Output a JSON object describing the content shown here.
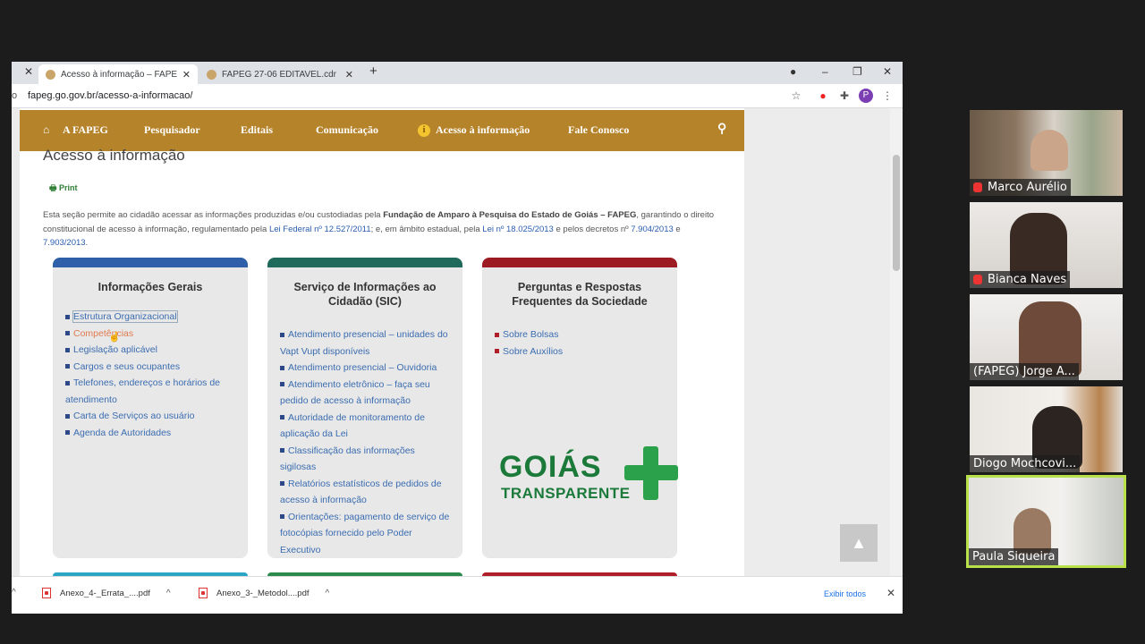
{
  "browser": {
    "tabs": [
      {
        "title": "Acesso à informação – FAPEG – F",
        "close": "✕"
      },
      {
        "title": "FAPEG 27-06 EDITAVEL.cdr",
        "close": "✕"
      }
    ],
    "new_tab": "+",
    "url": "fapeg.go.gov.br/acesso-a-informacao/",
    "profile_initial": "P"
  },
  "nav": {
    "items": [
      "A FAPEG",
      "Pesquisador",
      "Editais",
      "Comunicação",
      "Acesso à informação",
      "Fale Conosco"
    ]
  },
  "page": {
    "title": "Acesso à informação",
    "print": "Print",
    "intro_1": "Esta seção permite ao cidadão acessar as informações produzidas e/ou custodiadas pela ",
    "intro_bold": "Fundação de Amparo à Pesquisa do Estado de Goiás – FAPEG",
    "intro_2": ", garantindo o direito constitucional de acesso à informação, regulamentado pela ",
    "intro_link1": "Lei Federal nº 12.527/2011",
    "intro_3": "; e, em âmbito estadual, pela ",
    "intro_link2": "Lei nº 18.025/2013",
    "intro_4": " e pelos decretos nº ",
    "intro_link3": "7.904/2013",
    "intro_5": " e ",
    "intro_link4": "7.903/2013",
    "intro_6": "."
  },
  "cards": [
    {
      "title": "Informações Gerais",
      "color": "#2f5fa8",
      "items": [
        "Estrutura Organizacional",
        "Competências",
        "Legislação aplicável",
        "Cargos e seus ocupantes",
        "Telefones, endereços e horários de atendimento",
        "Carta de Serviços ao usuário",
        "Agenda de Autoridades"
      ]
    },
    {
      "title": "Serviço de Informações ao Cidadão (SIC)",
      "color": "#1f6a5a",
      "items": [
        "Atendimento presencial – unidades do Vapt Vupt disponíveis",
        "Atendimento presencial – Ouvidoria",
        "Atendimento eletrônico – faça seu pedido de acesso à informação",
        "Autoridade de monitoramento de aplicação da Lei",
        "Classificação das informações sigilosas",
        "Relatórios estatísticos de pedidos de acesso à informação",
        "Orientações: pagamento de serviço de fotocópias fornecido pelo Poder Executivo"
      ]
    },
    {
      "title": "Perguntas e Respostas Frequentes da Sociedade",
      "color": "#9c1b23",
      "items": [
        "Sobre Bolsas",
        "Sobre Auxílios"
      ]
    }
  ],
  "logo": {
    "line1": "GOIÁS",
    "line2": "TRANSPARENTE"
  },
  "downloads": {
    "files": [
      "Anexo_4-_Errata_....pdf",
      "Anexo_3-_Metodol....pdf"
    ],
    "show_all": "Exibir todos"
  },
  "participants": [
    {
      "name": "Marco Aurélio",
      "muted": true
    },
    {
      "name": "Bianca Naves",
      "muted": true
    },
    {
      "name": "(FAPEG) Jorge A...",
      "muted": false
    },
    {
      "name": "Diogo Mochcovi...",
      "muted": false
    },
    {
      "name": "Paula Siqueira",
      "muted": false,
      "speaking": true
    }
  ]
}
